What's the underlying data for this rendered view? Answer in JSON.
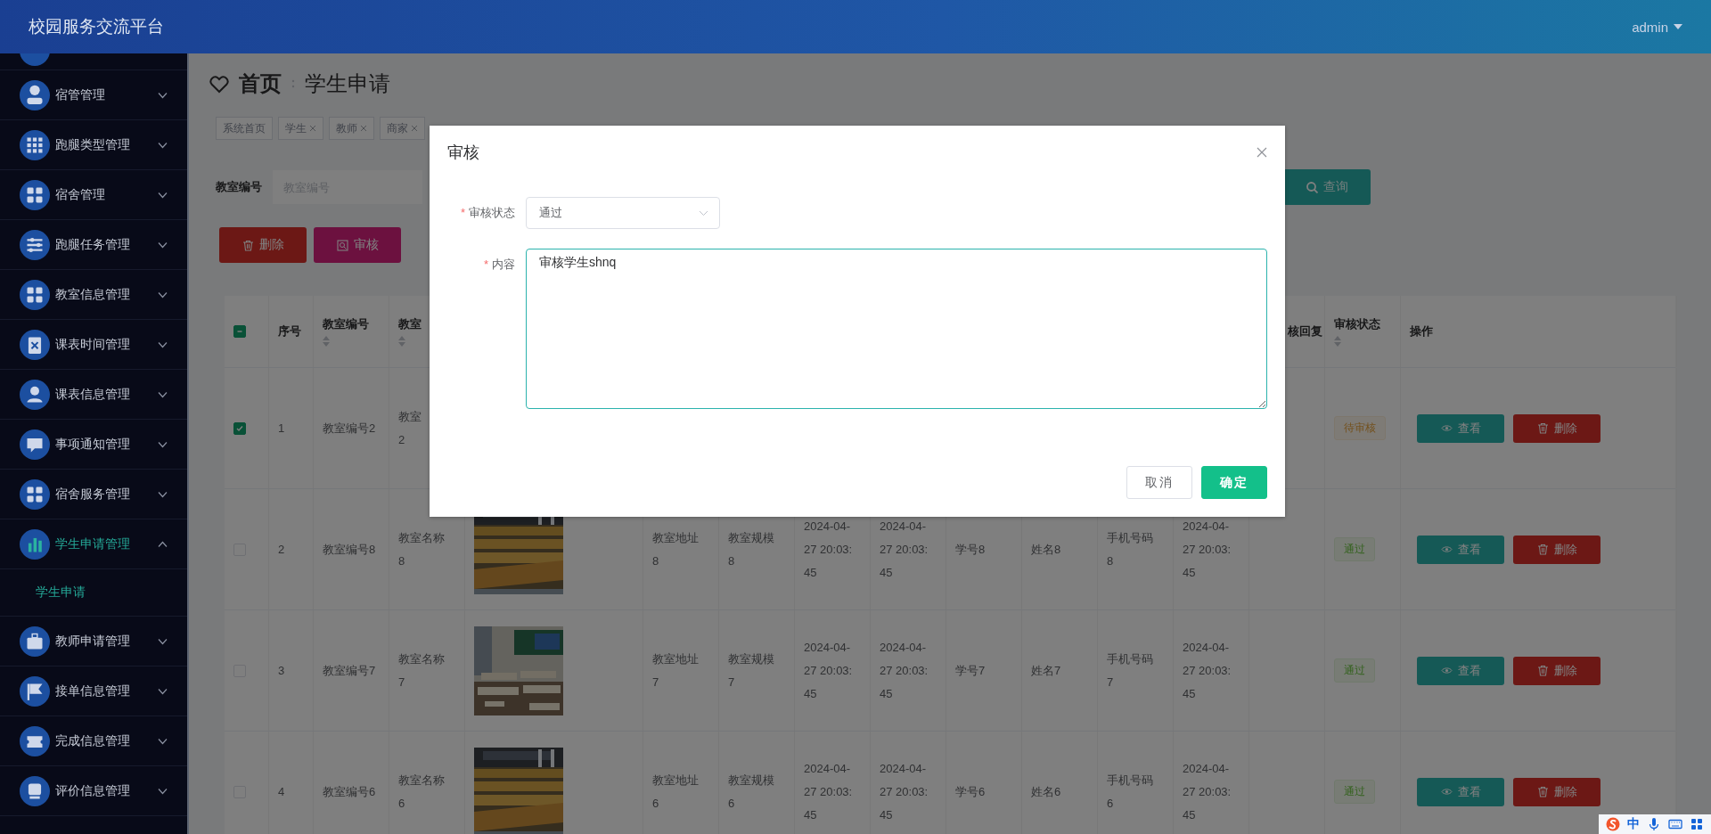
{
  "header": {
    "title": "校园服务交流平台",
    "user": "admin"
  },
  "sidebar": {
    "items": [
      {
        "label": "宿管管理",
        "expanded": false,
        "selected": false
      },
      {
        "label": "跑腿类型管理",
        "expanded": false,
        "selected": false
      },
      {
        "label": "宿舍管理",
        "expanded": false,
        "selected": false
      },
      {
        "label": "跑腿任务管理",
        "expanded": false,
        "selected": false
      },
      {
        "label": "教室信息管理",
        "expanded": false,
        "selected": false
      },
      {
        "label": "课表时间管理",
        "expanded": false,
        "selected": false
      },
      {
        "label": "课表信息管理",
        "expanded": false,
        "selected": false
      },
      {
        "label": "事项通知管理",
        "expanded": false,
        "selected": false
      },
      {
        "label": "宿舍服务管理",
        "expanded": false,
        "selected": false
      },
      {
        "label": "学生申请管理",
        "expanded": true,
        "selected": true,
        "children": [
          {
            "label": "学生申请",
            "selected": true
          }
        ]
      },
      {
        "label": "教师申请管理",
        "expanded": false,
        "selected": false
      },
      {
        "label": "接单信息管理",
        "expanded": false,
        "selected": false
      },
      {
        "label": "完成信息管理",
        "expanded": false,
        "selected": false
      },
      {
        "label": "评价信息管理",
        "expanded": false,
        "selected": false
      }
    ]
  },
  "breadcrumb": [
    "首页",
    "学生申请"
  ],
  "tags": [
    {
      "label": "系统首页",
      "closable": false
    },
    {
      "label": "学生",
      "closable": true
    },
    {
      "label": "教师",
      "closable": true
    },
    {
      "label": "商家",
      "closable": true
    }
  ],
  "search": {
    "label": "教室编号",
    "placeholder": "教室编号",
    "button": "查询"
  },
  "actions": [
    {
      "label": "删除",
      "kind": "delete"
    },
    {
      "label": "审核",
      "kind": "review"
    }
  ],
  "table": {
    "header_checkbox": {
      "checked": true,
      "partial": true
    },
    "columns": [
      {
        "label": "序号",
        "sortable": false
      },
      {
        "label": "教室编号",
        "sortable": true
      },
      {
        "label": "教室",
        "sortable": true
      },
      {
        "label": "核回复",
        "sortable": false
      },
      {
        "label": "审核状态",
        "sortable": true
      },
      {
        "label": "操作",
        "sortable": false
      }
    ],
    "rows": [
      {
        "checked": true,
        "no": "1",
        "code": "教室编号2",
        "name": [
          "教室",
          "2"
        ],
        "status": {
          "label": "待审核",
          "kind": "pending"
        },
        "view": "查看",
        "delete": "删除"
      },
      {
        "checked": false,
        "no": "2",
        "code": "教室编号8",
        "name": [
          "教室名称",
          "8"
        ],
        "photo": {
          "kind": "picture"
        },
        "address": [
          "教室地址",
          "8"
        ],
        "scale": [
          "教室规模",
          "8"
        ],
        "time_1": [
          "2024-04-",
          "27 20:03:",
          "45"
        ],
        "time_2": [
          "2024-04-",
          "27 20:03:",
          "45"
        ],
        "student_no": "学号8",
        "student_name": "姓名8",
        "phone": [
          "手机号码",
          "8"
        ],
        "time_3": [
          "2024-04-",
          "27 20:03:",
          "45"
        ],
        "status": {
          "label": "通过",
          "kind": "passed"
        },
        "view": "查看",
        "delete": "删除"
      },
      {
        "checked": false,
        "no": "3",
        "code": "教室编号7",
        "name": [
          "教室名称",
          "7"
        ],
        "photo": {
          "kind": "picture"
        },
        "address": [
          "教室地址",
          "7"
        ],
        "scale": [
          "教室规模",
          "7"
        ],
        "time_1": [
          "2024-04-",
          "27 20:03:",
          "45"
        ],
        "time_2": [
          "2024-04-",
          "27 20:03:",
          "45"
        ],
        "student_no": "学号7",
        "student_name": "姓名7",
        "phone": [
          "手机号码",
          "7"
        ],
        "time_3": [
          "2024-04-",
          "27 20:03:",
          "45"
        ],
        "status": {
          "label": "通过",
          "kind": "passed"
        },
        "view": "查看",
        "delete": "删除"
      },
      {
        "checked": false,
        "no": "4",
        "code": "教室编号6",
        "name": [
          "教室名称",
          "6"
        ],
        "photo": {
          "kind": "picture"
        },
        "address": [
          "教室地址",
          "6"
        ],
        "scale": [
          "教室规模",
          "6"
        ],
        "time_1": [
          "2024-04-",
          "27 20:03:",
          "45"
        ],
        "time_2": [
          "2024-04-",
          "27 20:03:",
          "45"
        ],
        "student_no": "学号6",
        "student_name": "姓名6",
        "phone": [
          "手机号码",
          "6"
        ],
        "time_3": [
          "2024-04-",
          "27 20:03:",
          "45"
        ],
        "status": {
          "label": "通过",
          "kind": "passed"
        },
        "view": "查看",
        "delete": "删除"
      }
    ]
  },
  "modal": {
    "title": "审核",
    "fields": [
      {
        "label": "审核状态",
        "required_mark": "*",
        "kind": "select",
        "value": "通过"
      },
      {
        "label": "内容",
        "required_mark": "*",
        "kind": "textarea",
        "value": "审核学生shnq"
      }
    ],
    "buttons": [
      {
        "label": "取消",
        "primary": false
      },
      {
        "label": "确定",
        "primary": true
      }
    ]
  },
  "ime": {
    "label": "中"
  }
}
